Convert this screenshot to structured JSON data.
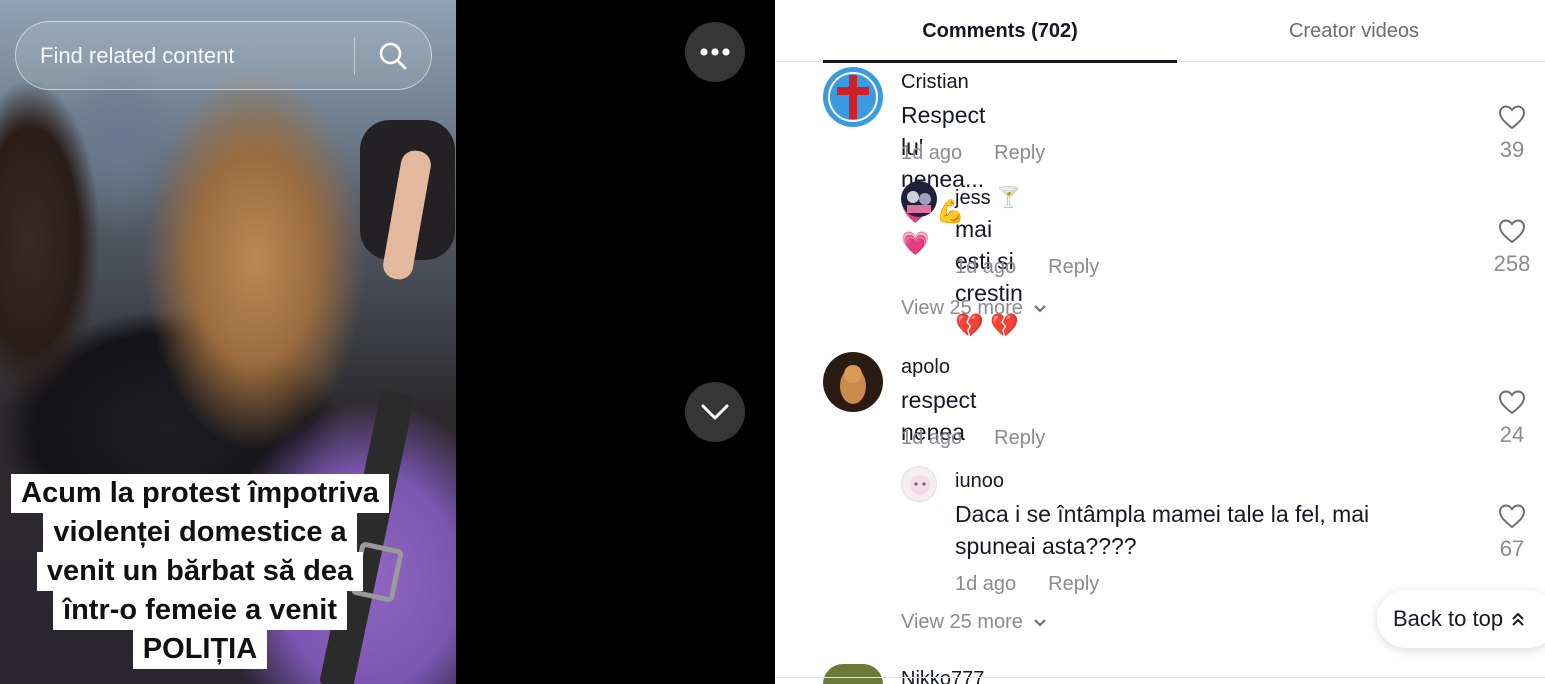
{
  "video": {
    "search_placeholder": "Find related content",
    "caption_lines": [
      "Acum la protest împotriva",
      "violenței domestice a",
      "venit un bărbat să dea",
      "într-o femeie a venit",
      "POLIȚIA"
    ],
    "icons": {
      "search": "search-icon",
      "more": "more-dots-icon",
      "next": "chevron-down-icon"
    }
  },
  "tabs": [
    {
      "label": "Comments (702)",
      "active": true
    },
    {
      "label": "Creator videos",
      "active": false
    }
  ],
  "comments": [
    {
      "username": "Cristian",
      "text": "Respect lu' nenea... 💗 💪 💗",
      "time": "1d ago",
      "reply_label": "Reply",
      "likes": "39"
    },
    {
      "username": "jess 🍸",
      "text": "mai esti si crestin 💔 💔",
      "time": "1d ago",
      "reply_label": "Reply",
      "likes": "258"
    },
    {
      "username": "apolo",
      "text": "respect nenea",
      "time": "1d ago",
      "reply_label": "Reply",
      "likes": "24"
    },
    {
      "username": "iunoo",
      "text": "Daca i se întâmpla mamei tale la fel, mai spuneai asta????",
      "time": "1d ago",
      "reply_label": "Reply",
      "likes": "67"
    }
  ],
  "view_more": [
    "View 25 more",
    "View 25 more"
  ],
  "partial_username": "Nikko777",
  "back_to_top": "Back to top",
  "colors": {
    "panel_bg": "#000000",
    "text_primary": "#161823",
    "text_secondary": "#8a8b91",
    "divider": "#e5e5e5"
  }
}
